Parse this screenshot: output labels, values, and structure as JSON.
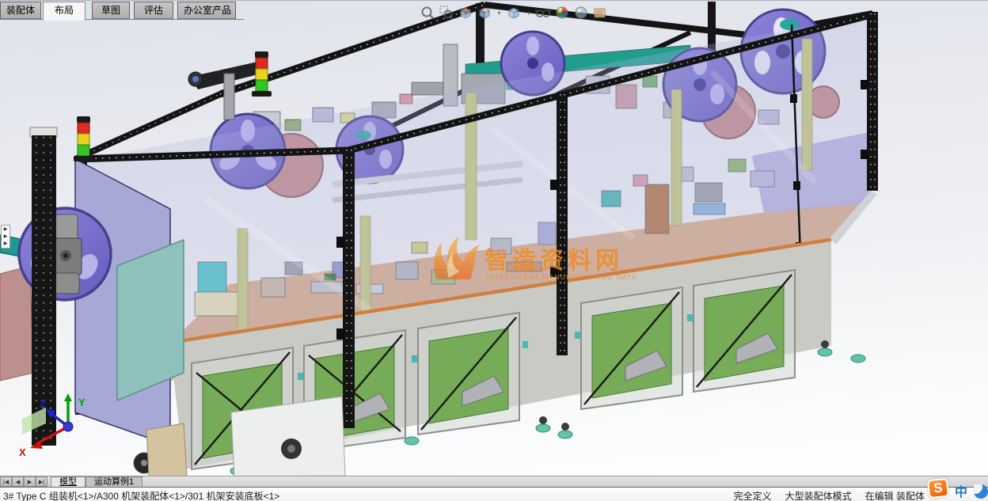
{
  "ribbon_tabs": [
    {
      "label": "装配体",
      "active": false
    },
    {
      "label": "布局",
      "active": true
    },
    {
      "label": "草图",
      "active": false
    },
    {
      "label": "评估",
      "active": false
    },
    {
      "label": "办公室产品",
      "active": false
    }
  ],
  "headsup_toolbar": {
    "icons": [
      "zoom-to-fit",
      "zoom-to-area",
      "section-view",
      "view-orientation",
      "display-style",
      "hide-show-items",
      "edit-appearance",
      "apply-scene",
      "view-settings"
    ],
    "caret": "▾"
  },
  "viewport": {
    "watermark": {
      "title": "智造资料网",
      "subtitle": "INTELLIGENT MANUFACTURING DATA"
    },
    "triad": {
      "x_label": "X",
      "y_label": "Y",
      "z_label": "Z"
    },
    "feature_panel_arrow": "▶"
  },
  "model_tabs": {
    "nav_buttons": [
      "|◀",
      "◀",
      "▶",
      "▶|"
    ],
    "tabs": [
      {
        "label": "模型",
        "active": true
      },
      {
        "label": "运动算例1",
        "active": false
      }
    ]
  },
  "status_bar": {
    "selection_path": "3# Type C 组装机<1>/A300 机架装配体<1>/301 机架安装底板<1>",
    "states": [
      "完全定义",
      "大型装配体模式",
      "在编辑 装配体"
    ],
    "ime_indicator": "中",
    "ime_logo_letter": "S"
  },
  "colors": {
    "accent_orange": "#f08a1f",
    "frame_black": "#151515",
    "panel_lavender": "#a8aad6",
    "reel_purple": "#776fc9",
    "deck_tan": "#d9ae8b",
    "deck_trim": "#cf7f3f",
    "cabinet_green": "#6fa84e",
    "teal": "#1d9a94",
    "signal_red": "#dd2b20",
    "signal_yellow": "#e8d21d",
    "signal_green": "#35c626"
  }
}
